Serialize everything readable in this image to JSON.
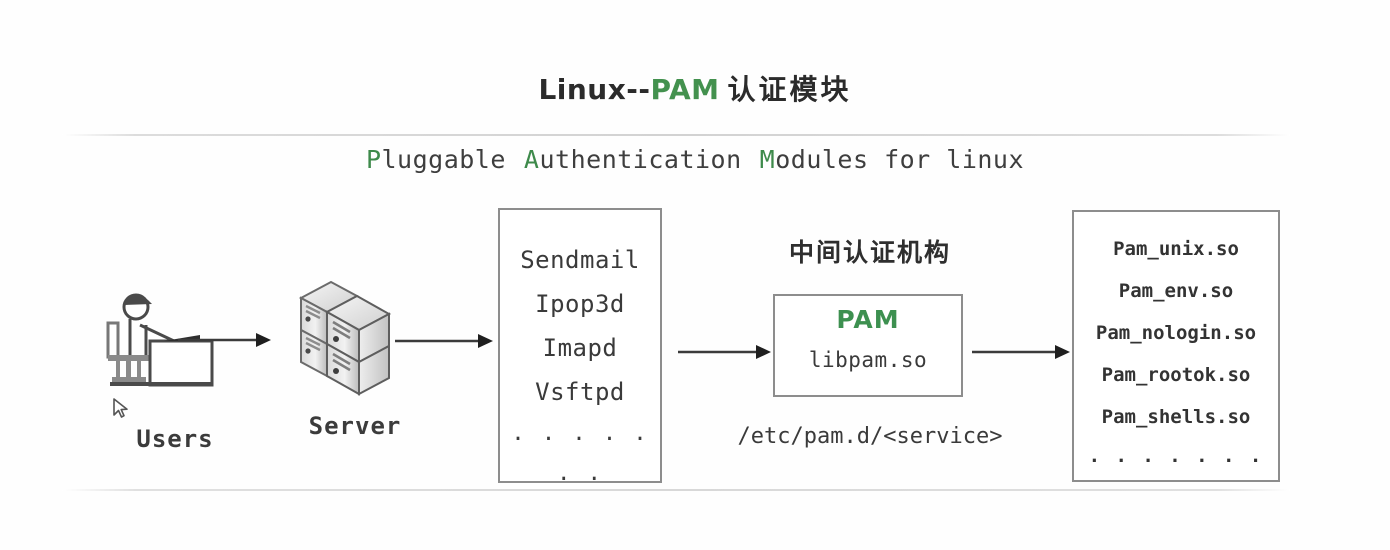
{
  "title": {
    "prefix": "Linux--",
    "accent": "PAM",
    "suffix": "认证模块"
  },
  "subtitle": {
    "w1_initial": "P",
    "w1_rest": "luggable",
    "w2_initial": "A",
    "w2_rest": "uthentication",
    "w3_initial": "M",
    "w3_rest": "odules for linux"
  },
  "colors": {
    "accent_green": "#43914e",
    "pam_green": "#3d9050",
    "box_border": "#8d8d8d",
    "text": "#333333",
    "rule": "#d2d2d2"
  },
  "nodes": {
    "users": {
      "label": "Users",
      "icon": "user-at-desk-icon"
    },
    "server": {
      "label": "Server",
      "icon": "server-stack-icon"
    }
  },
  "services_box": {
    "items": [
      "Sendmail",
      "Ipop3d",
      "Imapd",
      "Vsftpd"
    ],
    "ellipsis": ". . . . . . ."
  },
  "pam": {
    "heading": "中间认证机构",
    "name": "PAM",
    "library": "libpam.so",
    "config_path": "/etc/pam.d/<service>"
  },
  "modules_box": {
    "items": [
      "Pam_unix.so",
      "Pam_env.so",
      "Pam_nologin.so",
      "Pam_rootok.so",
      "Pam_shells.so"
    ],
    "ellipsis": ". . . . . . ."
  },
  "arrows": [
    {
      "name": "users-to-server"
    },
    {
      "name": "server-to-services"
    },
    {
      "name": "services-to-pam"
    },
    {
      "name": "pam-to-modules"
    }
  ]
}
